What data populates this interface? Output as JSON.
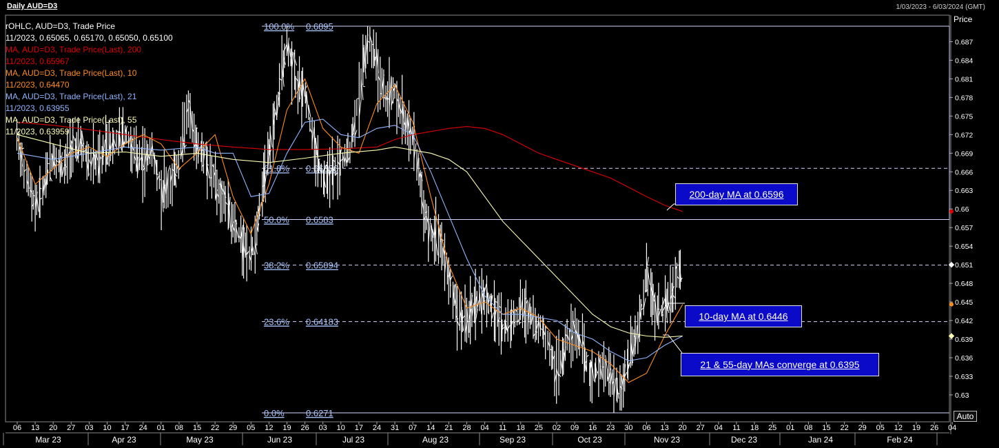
{
  "header": {
    "title": "Daily AUD=D3",
    "date_range": "1/03/2023 - 6/03/2024 (GMT)"
  },
  "legend": [
    {
      "text": "rOHLC, AUD=D3, Trade Price",
      "color": "#ffffff"
    },
    {
      "text": "11/2023, 0.65065, 0.65170, 0.65050, 0.65100",
      "color": "#ffffff"
    },
    {
      "text": "MA, AUD=D3, Trade Price(Last),  200",
      "color": "#e00000"
    },
    {
      "text": "11/2023, 0.65967",
      "color": "#e00000"
    },
    {
      "text": "MA, AUD=D3, Trade Price(Last),  10",
      "color": "#ff8c1a"
    },
    {
      "text": "11/2023, 0.64470",
      "color": "#ff8c1a"
    },
    {
      "text": "MA, AUD=D3, Trade Price(Last),  21",
      "color": "#8fb4ff"
    },
    {
      "text": "11/2023, 0.63955",
      "color": "#8fb4ff"
    },
    {
      "text": "MA, AUD=D3, Trade Price(Last),  55",
      "color": "#ffffb0"
    },
    {
      "text": "11/2023, 0.63959",
      "color": "#ffffb0"
    }
  ],
  "axis_title": "Price",
  "auto_button": "Auto",
  "callouts": {
    "ma200": "200-day MA at 0.6596",
    "ma10": "10-day MA at 0.6446",
    "ma21_55": "21 & 55-day MAs converge at 0.6395"
  },
  "colors": {
    "ma200": "#e00000",
    "ma10": "#ff8c1a",
    "ma21": "#8fb4ff",
    "ma55": "#ffffb0",
    "fib_label": "#a8c6ff",
    "callout_bg": "#0a0ac8"
  },
  "chart_data": {
    "type": "line",
    "ylim": [
      0.6271,
      0.6895
    ],
    "y_ticks": [
      "0.687",
      "0.684",
      "0.681",
      "0.678",
      "0.675",
      "0.672",
      "0.669",
      "0.666",
      "0.663",
      "0.66",
      "0.657",
      "0.654",
      "0.651",
      "0.648",
      "0.645",
      "0.642",
      "0.639",
      "0.636",
      "0.633",
      "0.63"
    ],
    "x_day_ticks": [
      "06",
      "13",
      "20",
      "27",
      "03",
      "10",
      "17",
      "24",
      "01",
      "08",
      "15",
      "22",
      "29",
      "05",
      "12",
      "19",
      "26",
      "03",
      "10",
      "17",
      "24",
      "31",
      "07",
      "14",
      "21",
      "28",
      "04",
      "11",
      "18",
      "25",
      "02",
      "09",
      "16",
      "23",
      "30",
      "06",
      "13",
      "20",
      "27",
      "04",
      "11",
      "18",
      "25",
      "01",
      "08",
      "15",
      "22",
      "29",
      "05",
      "12",
      "19",
      "26",
      "04"
    ],
    "x_month_labels": [
      "Mar 23",
      "Apr 23",
      "May 23",
      "Jun 23",
      "Jul 23",
      "Aug 23",
      "Sep 23",
      "Oct 23",
      "Nov 23",
      "Dec 23",
      "Jan 24",
      "Feb 24"
    ],
    "fib_levels": [
      {
        "pct": "100.0%",
        "value": "0.6895",
        "y": 0.6895,
        "style": "solid"
      },
      {
        "pct": "61.8%",
        "value": "0.66656",
        "y": 0.66656,
        "style": "dashed"
      },
      {
        "pct": "50.0%",
        "value": "0.6583",
        "y": 0.6583,
        "style": "solid"
      },
      {
        "pct": "38.2%",
        "value": "0.65094",
        "y": 0.65094,
        "style": "dashed"
      },
      {
        "pct": "23.6%",
        "value": "0.64183",
        "y": 0.64183,
        "style": "dashed"
      },
      {
        "pct": "0.0%",
        "value": "0.6271",
        "y": 0.6271,
        "style": "solid"
      }
    ],
    "price_path": [
      [
        0,
        0.6712
      ],
      [
        0.5,
        0.665
      ],
      [
        1,
        0.6605
      ],
      [
        1.5,
        0.664
      ],
      [
        2,
        0.669
      ],
      [
        2.5,
        0.6665
      ],
      [
        3,
        0.6695
      ],
      [
        3.5,
        0.6705
      ],
      [
        4,
        0.668
      ],
      [
        4.5,
        0.6672
      ],
      [
        5,
        0.6702
      ],
      [
        5.5,
        0.6713
      ],
      [
        6,
        0.6722
      ],
      [
        6.5,
        0.669
      ],
      [
        7,
        0.6675
      ],
      [
        7.5,
        0.6695
      ],
      [
        8,
        0.6628
      ],
      [
        8.5,
        0.664
      ],
      [
        9,
        0.668
      ],
      [
        9.5,
        0.676
      ],
      [
        10,
        0.67
      ],
      [
        10.5,
        0.6685
      ],
      [
        11,
        0.664
      ],
      [
        11.5,
        0.662
      ],
      [
        12,
        0.658
      ],
      [
        12.5,
        0.6545
      ],
      [
        13,
        0.652
      ],
      [
        13.5,
        0.66
      ],
      [
        14,
        0.67
      ],
      [
        14.5,
        0.678
      ],
      [
        15,
        0.687
      ],
      [
        15.5,
        0.68
      ],
      [
        16,
        0.679
      ],
      [
        16.5,
        0.67
      ],
      [
        17,
        0.665
      ],
      [
        17.5,
        0.666
      ],
      [
        18,
        0.667
      ],
      [
        18.5,
        0.67
      ],
      [
        19,
        0.678
      ],
      [
        19.5,
        0.688
      ],
      [
        20,
        0.683
      ],
      [
        20.5,
        0.678
      ],
      [
        21,
        0.679
      ],
      [
        21.5,
        0.674
      ],
      [
        22,
        0.672
      ],
      [
        22.5,
        0.662
      ],
      [
        23,
        0.656
      ],
      [
        23.5,
        0.655
      ],
      [
        24,
        0.649
      ],
      [
        24.5,
        0.643
      ],
      [
        25,
        0.6425
      ],
      [
        25.5,
        0.6445
      ],
      [
        26,
        0.646
      ],
      [
        26.5,
        0.644
      ],
      [
        27,
        0.641
      ],
      [
        27.5,
        0.642
      ],
      [
        28,
        0.644
      ],
      [
        28.5,
        0.643
      ],
      [
        29,
        0.641
      ],
      [
        29.5,
        0.639
      ],
      [
        30,
        0.634
      ],
      [
        30.5,
        0.638
      ],
      [
        31,
        0.641
      ],
      [
        31.5,
        0.636
      ],
      [
        32,
        0.633
      ],
      [
        32.5,
        0.635
      ],
      [
        33,
        0.632
      ],
      [
        33.5,
        0.63
      ],
      [
        34,
        0.636
      ],
      [
        34.5,
        0.64
      ],
      [
        35,
        0.65
      ],
      [
        35.5,
        0.643
      ],
      [
        36,
        0.644
      ],
      [
        36.5,
        0.647
      ],
      [
        37,
        0.6512
      ]
    ],
    "series": [
      {
        "label": "200",
        "color": "#e00000",
        "points": [
          [
            0,
            0.674
          ],
          [
            2,
            0.6735
          ],
          [
            4,
            0.6728
          ],
          [
            6,
            0.672
          ],
          [
            8,
            0.6712
          ],
          [
            10,
            0.6705
          ],
          [
            12,
            0.67
          ],
          [
            14,
            0.6696
          ],
          [
            16,
            0.6696
          ],
          [
            18,
            0.6697
          ],
          [
            20,
            0.67
          ],
          [
            21,
            0.6712
          ],
          [
            22,
            0.672
          ],
          [
            23,
            0.6725
          ],
          [
            24,
            0.673
          ],
          [
            25,
            0.6733
          ],
          [
            26,
            0.673
          ],
          [
            27,
            0.672
          ],
          [
            28,
            0.6705
          ],
          [
            29,
            0.669
          ],
          [
            30,
            0.668
          ],
          [
            31,
            0.667
          ],
          [
            32,
            0.666
          ],
          [
            33,
            0.665
          ],
          [
            34,
            0.6635
          ],
          [
            35,
            0.662
          ],
          [
            36,
            0.6606
          ],
          [
            37,
            0.6596
          ]
        ]
      },
      {
        "label": "10",
        "color": "#ff8c1a",
        "points": [
          [
            0,
            0.6715
          ],
          [
            1,
            0.664
          ],
          [
            2,
            0.6665
          ],
          [
            3,
            0.669
          ],
          [
            4,
            0.67
          ],
          [
            5,
            0.6685
          ],
          [
            6,
            0.6705
          ],
          [
            7,
            0.672
          ],
          [
            8,
            0.6705
          ],
          [
            9,
            0.6665
          ],
          [
            10,
            0.669
          ],
          [
            11,
            0.672
          ],
          [
            12,
            0.662
          ],
          [
            13,
            0.656
          ],
          [
            14,
            0.664
          ],
          [
            15,
            0.676
          ],
          [
            16,
            0.681
          ],
          [
            17,
            0.673
          ],
          [
            18,
            0.67
          ],
          [
            19,
            0.669
          ],
          [
            20,
            0.677
          ],
          [
            21,
            0.68
          ],
          [
            22,
            0.674
          ],
          [
            23,
            0.662
          ],
          [
            24,
            0.651
          ],
          [
            25,
            0.644
          ],
          [
            26,
            0.645
          ],
          [
            27,
            0.643
          ],
          [
            28,
            0.644
          ],
          [
            29,
            0.6425
          ],
          [
            30,
            0.639
          ],
          [
            31,
            0.638
          ],
          [
            32,
            0.637
          ],
          [
            33,
            0.635
          ],
          [
            34,
            0.632
          ],
          [
            35,
            0.6335
          ],
          [
            36,
            0.6395
          ],
          [
            37,
            0.6446
          ]
        ]
      },
      {
        "label": "21",
        "color": "#8fb4ff",
        "points": [
          [
            0,
            0.669
          ],
          [
            2,
            0.668
          ],
          [
            4,
            0.669
          ],
          [
            6,
            0.67
          ],
          [
            8,
            0.6695
          ],
          [
            10,
            0.67
          ],
          [
            11,
            0.669
          ],
          [
            12,
            0.669
          ],
          [
            13,
            0.662
          ],
          [
            14,
            0.6625
          ],
          [
            15,
            0.669
          ],
          [
            16,
            0.674
          ],
          [
            17,
            0.6745
          ],
          [
            18,
            0.672
          ],
          [
            19,
            0.6715
          ],
          [
            20,
            0.673
          ],
          [
            21,
            0.6735
          ],
          [
            22,
            0.672
          ],
          [
            23,
            0.666
          ],
          [
            24,
            0.659
          ],
          [
            25,
            0.652
          ],
          [
            26,
            0.646
          ],
          [
            27,
            0.643
          ],
          [
            28,
            0.643
          ],
          [
            29,
            0.6425
          ],
          [
            30,
            0.642
          ],
          [
            31,
            0.64
          ],
          [
            32,
            0.639
          ],
          [
            33,
            0.637
          ],
          [
            34,
            0.6355
          ],
          [
            35,
            0.636
          ],
          [
            36,
            0.638
          ],
          [
            37,
            0.6395
          ]
        ]
      },
      {
        "label": "55",
        "color": "#ffffb0",
        "points": [
          [
            0,
            0.672
          ],
          [
            2,
            0.6705
          ],
          [
            4,
            0.669
          ],
          [
            6,
            0.6692
          ],
          [
            8,
            0.6685
          ],
          [
            10,
            0.669
          ],
          [
            12,
            0.668
          ],
          [
            14,
            0.6675
          ],
          [
            16,
            0.6682
          ],
          [
            18,
            0.669
          ],
          [
            20,
            0.6695
          ],
          [
            21,
            0.67
          ],
          [
            22,
            0.6695
          ],
          [
            23,
            0.669
          ],
          [
            24,
            0.668
          ],
          [
            25,
            0.666
          ],
          [
            26,
            0.662
          ],
          [
            27,
            0.658
          ],
          [
            28,
            0.655
          ],
          [
            29,
            0.652
          ],
          [
            30,
            0.649
          ],
          [
            31,
            0.646
          ],
          [
            32,
            0.643
          ],
          [
            33,
            0.641
          ],
          [
            34,
            0.64
          ],
          [
            35,
            0.6395
          ],
          [
            36,
            0.6393
          ],
          [
            37,
            0.6395
          ]
        ]
      }
    ]
  }
}
